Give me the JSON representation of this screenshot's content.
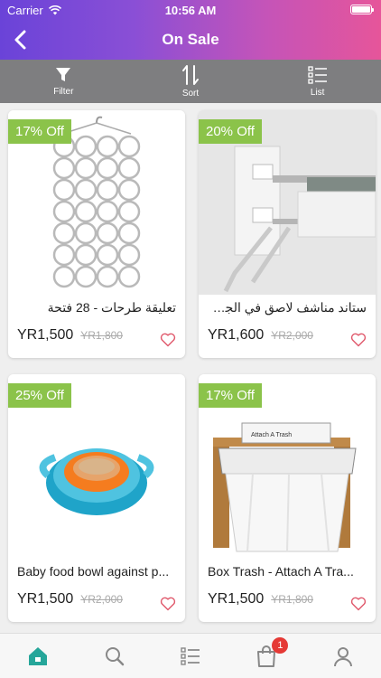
{
  "status_bar": {
    "carrier": "Carrier",
    "time": "10:56 AM"
  },
  "header": {
    "title": "On Sale",
    "back_icon": "chevron-left-icon"
  },
  "toolbar": {
    "filter_label": "Filter",
    "sort_label": "Sort",
    "list_label": "List"
  },
  "products": [
    {
      "discount": "17% Off",
      "name": "تعليقة طرحات - 28 فتحة",
      "price": "YR1,500",
      "old_price": "YR1,800"
    },
    {
      "discount": "20% Off",
      "name": "ستاند مناشف لاصق في الجدا...",
      "price": "YR1,600",
      "old_price": "YR2,000"
    },
    {
      "discount": "25% Off",
      "name": "Baby food bowl against p...",
      "price": "YR1,500",
      "old_price": "YR2,000"
    },
    {
      "discount": "17% Off",
      "name": "Box Trash - Attach A Tra...",
      "price": "YR1,500",
      "old_price": "YR1,800",
      "image_text": "Attach A Trash"
    }
  ],
  "tabbar": {
    "cart_count": "1"
  },
  "colors": {
    "accent": "#26a69a",
    "badge": "#8bc34a",
    "heart": "#e05a6d",
    "cart_badge": "#e53935"
  }
}
